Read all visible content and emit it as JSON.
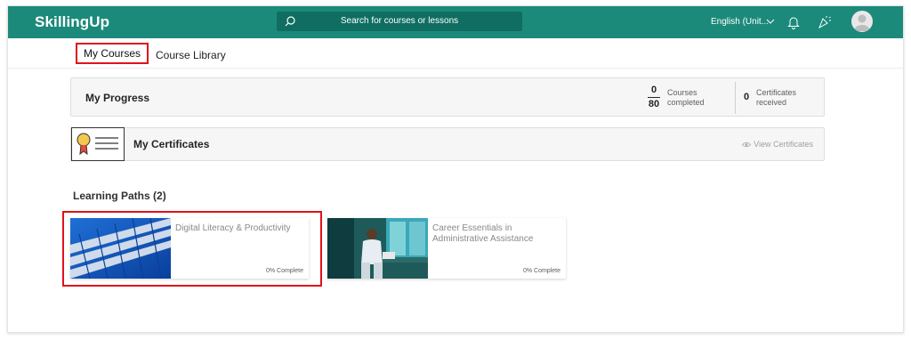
{
  "header": {
    "brand": "SkillingUp",
    "search_placeholder": "Search for courses or lessons",
    "language": "English (Unit...",
    "icons": [
      "search-icon",
      "chevron-down-icon",
      "bell-icon",
      "celebrate-icon",
      "avatar-icon"
    ]
  },
  "tabs": [
    {
      "label": "My Courses",
      "active": true
    },
    {
      "label": "Course Library",
      "active": false
    }
  ],
  "progress": {
    "title": "My Progress",
    "courses_completed": "0",
    "courses_total": "80",
    "courses_label_1": "Courses",
    "courses_label_2": "completed",
    "certificates_count": "0",
    "certificates_label_1": "Certificates",
    "certificates_label_2": "received"
  },
  "certificates": {
    "title": "My Certificates",
    "view_link": "View Certificates"
  },
  "learning_paths": {
    "heading": "Learning Paths (2)",
    "items": [
      {
        "title": "Digital Literacy & Productivity",
        "status": "0% Complete"
      },
      {
        "title": "Career Essentials in Administrative Assistance",
        "status": "0% Complete"
      }
    ]
  },
  "colors": {
    "header_bg": "#1b8a7a",
    "highlight": "#e0121b"
  }
}
